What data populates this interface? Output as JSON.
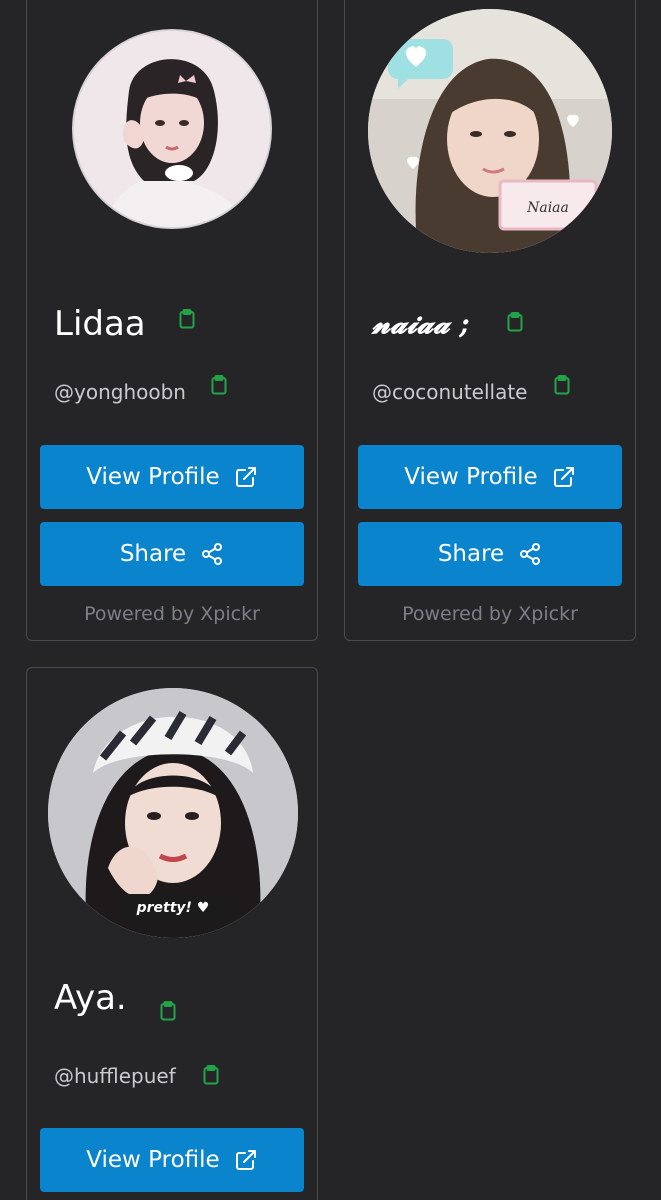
{
  "cards": [
    {
      "display_name": "Lidaa",
      "username": "@yonghoobn",
      "view_label": "View Profile",
      "share_label": "Share",
      "powered": "Powered by Xpickr"
    },
    {
      "display_name": "𝓷𝓪𝓲𝓪𝓪 ;",
      "username": "@coconutellate",
      "view_label": "View Profile",
      "share_label": "Share",
      "powered": "Powered by Xpickr",
      "avatar_badge": "Naiaa"
    },
    {
      "display_name": "Aya.",
      "username": "@hufflepuef",
      "view_label": "View Profile",
      "avatar_caption": "pretty! ♥"
    }
  ],
  "colors": {
    "background": "#252528",
    "card_border": "#4a4b50",
    "button": "#0a84cc",
    "copy_icon": "#22a34a",
    "muted_text": "#7d7f88"
  },
  "icons": {
    "copy": "clipboard-icon",
    "external": "external-link-icon",
    "share": "share-icon"
  }
}
